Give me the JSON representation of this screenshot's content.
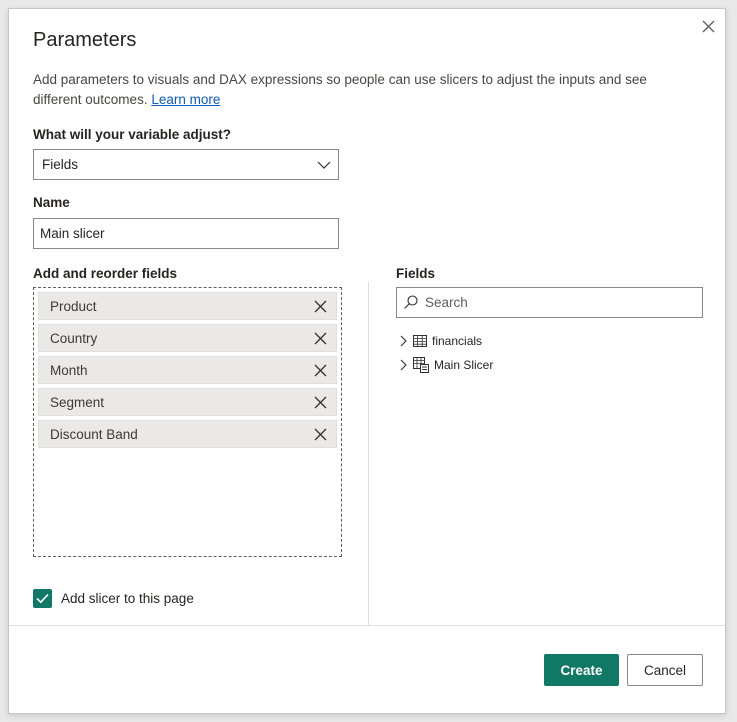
{
  "dialog": {
    "title": "Parameters",
    "description": "Add parameters to visuals and DAX expressions so people can use slicers to adjust the inputs and see different outcomes.",
    "learn_more": "Learn more",
    "close_icon": "close-icon"
  },
  "variable": {
    "label": "What will your variable adjust?",
    "selected": "Fields"
  },
  "name": {
    "label": "Name",
    "value": "Main slicer"
  },
  "reorder": {
    "label": "Add and reorder fields",
    "items": [
      {
        "label": "Product"
      },
      {
        "label": "Country"
      },
      {
        "label": "Month"
      },
      {
        "label": "Segment"
      },
      {
        "label": "Discount Band"
      }
    ]
  },
  "fields": {
    "label": "Fields",
    "search_placeholder": "Search",
    "tree": [
      {
        "label": "financials",
        "icon": "table-icon"
      },
      {
        "label": "Main Slicer",
        "icon": "calculated-table-icon"
      }
    ]
  },
  "slicer_checkbox": {
    "label": "Add slicer to this page",
    "checked": true
  },
  "buttons": {
    "create": "Create",
    "cancel": "Cancel"
  },
  "colors": {
    "accent": "#117865",
    "link": "#0f5bb5"
  }
}
